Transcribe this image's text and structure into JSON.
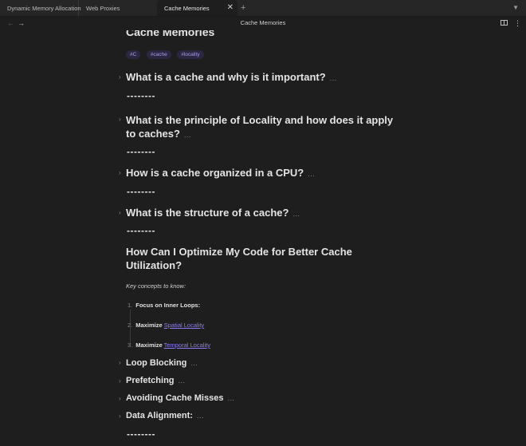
{
  "tabs": [
    {
      "label": "Dynamic Memory Allocation"
    },
    {
      "label": "Web Proxies"
    },
    {
      "label": "Cache Memories",
      "active": true
    }
  ],
  "nav": {
    "title": "Cache Memories"
  },
  "document": {
    "title": "Cache Memories",
    "tags": [
      "#C",
      "#cache",
      "#locality"
    ],
    "ellipsis": "...",
    "rule": "--------",
    "headings": [
      {
        "text": "What is a cache and why is it important?"
      },
      {
        "text": "What is the principle of Locality and how does it apply to caches?"
      },
      {
        "text": "How is a cache organized in a CPU?"
      },
      {
        "text": "What is the structure of a cache?"
      },
      {
        "text": "How Can I Optimize My Code for Better Cache Utilization?"
      }
    ],
    "intro": "Key concepts to know:",
    "list": [
      {
        "num": "1.",
        "bold": "Focus on Inner Loops:",
        "link": ""
      },
      {
        "num": "2.",
        "bold": "Maximize",
        "link": "Spatial Locality"
      },
      {
        "num": "3.",
        "bold": "Maximize",
        "link": "Temporal Locality"
      }
    ],
    "subheadings": [
      {
        "text": "Loop Blocking"
      },
      {
        "text": "Prefetching"
      },
      {
        "text": "Avoiding Cache Misses"
      },
      {
        "text": "Data Alignment:"
      }
    ]
  },
  "colors": {
    "accent": "#8b7cf6",
    "tag_bg": "#2b2740",
    "background": "#1e1e1e"
  }
}
